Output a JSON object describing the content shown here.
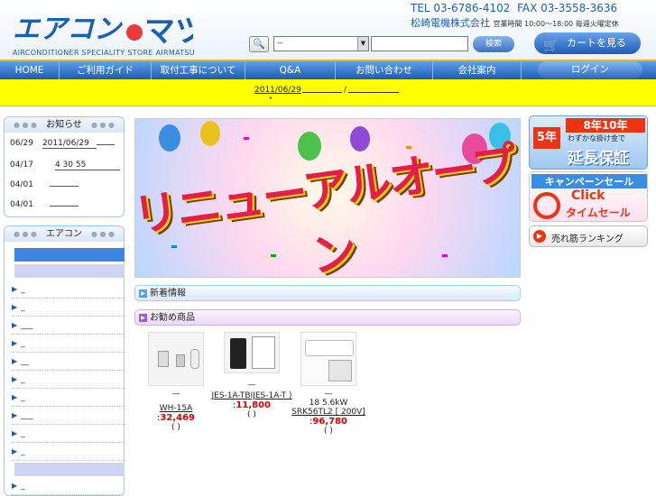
{
  "header": {
    "logo_text": "エアコンのマツ",
    "logo_sub": "AIRCONDITIONER SPECIALITY STORE AIRMATSU",
    "tel": "TEL 03-6786-4102",
    "fax": "FAX 03-3558-3636",
    "company": "松崎電機株式会社",
    "hours": "営業時間 10:00～18:00 毎週火曜定休"
  },
  "search": {
    "category_value": "--",
    "input_value": "",
    "submit_label": "検索",
    "cart_label": "カートを見る"
  },
  "nav": {
    "items": [
      {
        "label": "HOME"
      },
      {
        "label": "ご利用ガイド"
      },
      {
        "label": "取付工事について"
      },
      {
        "label": "Q&A"
      },
      {
        "label": "お問い合わせ"
      },
      {
        "label": "会社案内"
      }
    ],
    "login_label": "ログイン"
  },
  "ticker": {
    "date_link": "2011/06/29",
    "separator": "/"
  },
  "news": {
    "title": "お知らせ",
    "items": [
      {
        "date": "06/29",
        "text": "2011/06/29"
      },
      {
        "date": "04/17",
        "text": "4 30 55"
      },
      {
        "date": "04/01",
        "text": ""
      },
      {
        "date": "04/01",
        "text": ""
      }
    ]
  },
  "aircon": {
    "title": "エアコン",
    "items": [
      "_",
      "_",
      "___",
      "_",
      "__",
      "_",
      "_",
      "___",
      "_",
      "_",
      "_"
    ]
  },
  "banner": {
    "text": "リニューアルオープン"
  },
  "sections": {
    "new_info": "新着情報",
    "recommended": "お勧め商品"
  },
  "products": [
    {
      "dash": "—",
      "name": "WH-15A",
      "price_prefix": ":",
      "price": "32,469",
      "paren": "( )"
    },
    {
      "dash": "—",
      "name": "JES-1A-TBIJES-1A-T )",
      "price_prefix": ":",
      "price": "11,800",
      "paren": "( )"
    },
    {
      "dash": "—",
      "name_line1": "18 5.6kW",
      "name": "SRK56TL2 [ 200V]",
      "price_prefix": ":",
      "price": "96,780",
      "paren": "( )"
    }
  ],
  "side_ads": {
    "warranty_a": "5年",
    "warranty_b": "8年10年",
    "warranty_sub": "わずかな掛け金で",
    "warranty_main": "延長保証",
    "campaign": "キャンペーンセール",
    "click": "Click",
    "timesale": "タイムセール",
    "ranking": "売れ筋ランキング"
  },
  "colors": {
    "brand_blue": "#1a5fb4",
    "nav_accent": "#ffb300",
    "ticker_yellow": "#ffff00",
    "price_red": "#e00000"
  }
}
